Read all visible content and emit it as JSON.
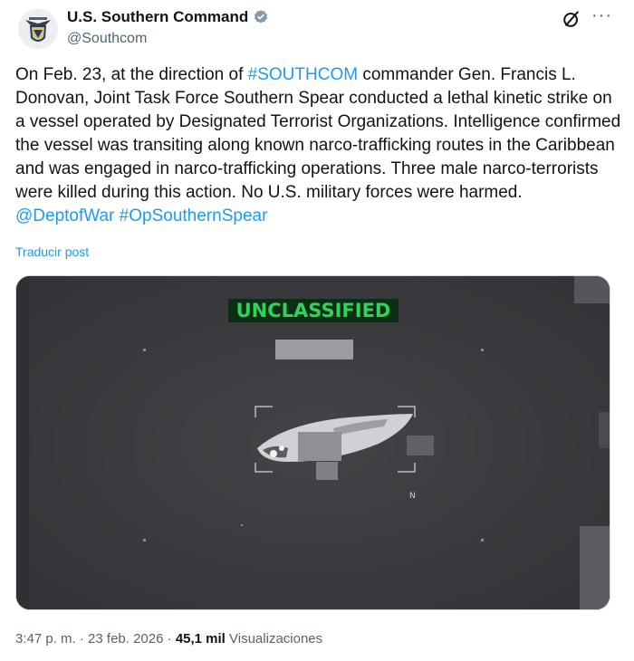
{
  "author": {
    "name": "U.S. Southern Command",
    "handle": "@Southcom",
    "verified": true,
    "avatar_icon": "southcom-emblem"
  },
  "post": {
    "text_before": "On Feb. 23, at the direction of ",
    "hashtag_1": "#SOUTHCOM",
    "text_after": " commander Gen. Francis L. Donovan, Joint Task Force Southern Spear conducted a lethal kinetic strike on a vessel operated by Designated Terrorist Organizations. Intelligence confirmed the vessel was transiting along known narco-trafficking routes in the Caribbean and was engaged in narco-trafficking operations. Three male narco-terrorists were killed during this action. No U.S. military forces were harmed. ",
    "mention": "@DeptofWar",
    "hashtag_2": "#OpSouthernSpear",
    "translate": "Traducir post"
  },
  "media": {
    "banner": "UNCLASSIFIED",
    "north_label": "N",
    "colors": {
      "background": "#3b3c3f",
      "banner_bg": "#0c2e14",
      "banner_text": "#2fd35c"
    }
  },
  "meta": {
    "time": "3:47 p. m.",
    "sep1": " · ",
    "date": "23 feb. 2026",
    "sep2": " · ",
    "views_count": "45,1 mil",
    "views_label": " Visualizaciones"
  },
  "colors": {
    "link": "#1d9bf0",
    "muted": "#536471",
    "text": "#0f1419"
  }
}
